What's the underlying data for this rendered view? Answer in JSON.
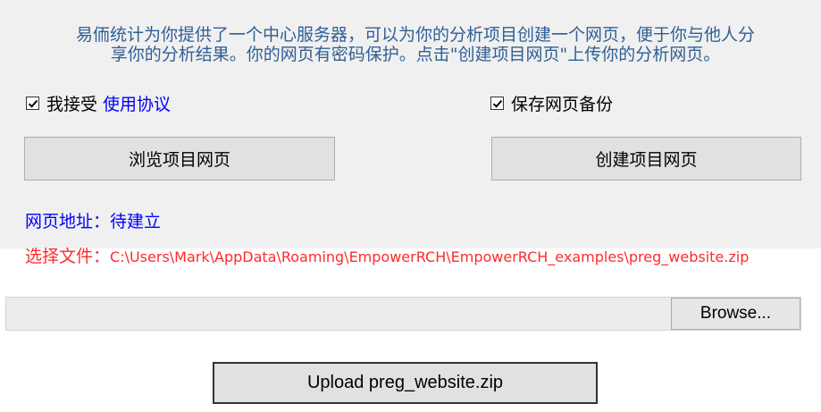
{
  "intro": {
    "line1": "易侕统计为你提供了一个中心服务器，可以为你的分析项目创建一个网页，便于你与他人分",
    "line2": "享你的分析结果。你的网页有密码保护。点击\"创建项目网页\"上传你的分析网页。"
  },
  "agreement": {
    "checked": true,
    "label": "我接受",
    "link": "使用协议"
  },
  "backup": {
    "checked": true,
    "label": "保存网页备份"
  },
  "buttons": {
    "browse_project": "浏览项目网页",
    "create_project": "创建项目网页"
  },
  "address": {
    "label": "网页地址：",
    "value": "待建立"
  },
  "file": {
    "label": "选择文件：",
    "path": "C:\\Users\\Mark\\AppData\\Roaming\\EmpowerRCH\\EmpowerRCH_examples\\preg_website.zip"
  },
  "file_input": {
    "value": "",
    "browse_label": "Browse..."
  },
  "upload": {
    "label": "Upload preg_website.zip"
  }
}
